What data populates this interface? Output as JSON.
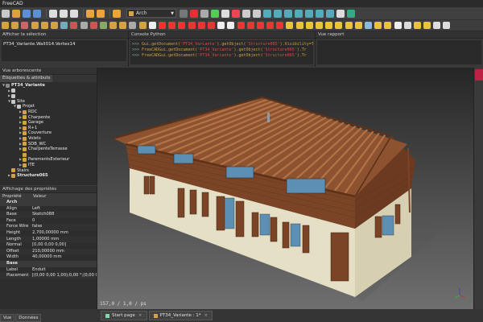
{
  "app": {
    "title": "FreeCAD"
  },
  "toolbar": {
    "workbench": "Arch",
    "row1_icons": [
      {
        "name": "new-file-icon",
        "color": "#c8c8c8"
      },
      {
        "name": "open-file-icon",
        "color": "#d9a23a"
      },
      {
        "name": "save-icon",
        "color": "#5b8fd6"
      },
      {
        "name": "save-as-icon",
        "color": "#5b8fd6"
      },
      {
        "name": "cut-icon",
        "color": "#ddd"
      },
      {
        "name": "copy-icon",
        "color": "#ddd"
      },
      {
        "name": "paste-icon",
        "color": "#ddd"
      },
      {
        "name": "undo-icon",
        "color": "#e9a53c"
      },
      {
        "name": "redo-icon",
        "color": "#e9a53c"
      },
      {
        "name": "refresh-icon",
        "color": "#e9a53c"
      }
    ],
    "row1_right_icons": [
      {
        "name": "macro-record-icon",
        "color": "#777"
      },
      {
        "name": "macro-stop-icon",
        "color": "#d33"
      },
      {
        "name": "macro-edit-icon",
        "color": "#aaa"
      },
      {
        "name": "macro-run-icon",
        "color": "#5c5"
      },
      {
        "name": "link-icon",
        "color": "#ddd"
      },
      {
        "name": "std-view-icon",
        "color": "#e45"
      },
      {
        "name": "fit-all-icon",
        "color": "#ccc"
      },
      {
        "name": "draw-style-icon",
        "color": "#ccc"
      },
      {
        "name": "view-iso-icon",
        "color": "#5ab"
      },
      {
        "name": "view-front-icon",
        "color": "#5ab"
      },
      {
        "name": "view-top-icon",
        "color": "#5ab"
      },
      {
        "name": "view-right-icon",
        "color": "#5ab"
      },
      {
        "name": "view-rear-icon",
        "color": "#5ab"
      },
      {
        "name": "view-bottom-icon",
        "color": "#5ab"
      },
      {
        "name": "view-left-icon",
        "color": "#5ab"
      },
      {
        "name": "measure-icon",
        "color": "#ddd"
      },
      {
        "name": "url-icon",
        "color": "#3a8"
      }
    ],
    "row2_icons": [
      {
        "name": "wall-icon",
        "color": "#d4a241"
      },
      {
        "name": "structure-icon",
        "color": "#d4a241"
      },
      {
        "name": "rebar-icon",
        "color": "#c66"
      },
      {
        "name": "floor-icon",
        "color": "#d4a241"
      },
      {
        "name": "building-icon",
        "color": "#d4a241"
      },
      {
        "name": "site-icon",
        "color": "#d4a241"
      },
      {
        "name": "window-icon",
        "color": "#7ab"
      },
      {
        "name": "roof-icon",
        "color": "#c55"
      },
      {
        "name": "axis-icon",
        "color": "#aaa"
      },
      {
        "name": "section-icon",
        "color": "#c55"
      },
      {
        "name": "space-icon",
        "color": "#8a6"
      },
      {
        "name": "stairs-icon",
        "color": "#d4a241"
      },
      {
        "name": "panel-icon",
        "color": "#d4a241"
      },
      {
        "name": "equipment-icon",
        "color": "#aaa"
      },
      {
        "name": "frame-icon",
        "color": "#d4a241"
      },
      {
        "name": "schedule-icon",
        "color": "#eee"
      },
      {
        "name": "line-icon",
        "color": "#e33"
      },
      {
        "name": "wire-icon",
        "color": "#e33"
      },
      {
        "name": "circle-icon",
        "color": "#e33"
      },
      {
        "name": "arc-icon",
        "color": "#e33"
      },
      {
        "name": "polygon-icon",
        "color": "#e33"
      },
      {
        "name": "rectangle-icon",
        "color": "#e33"
      },
      {
        "name": "text-icon",
        "color": "#eee"
      },
      {
        "name": "dimension-icon",
        "color": "#eee"
      },
      {
        "name": "bspline-icon",
        "color": "#e33"
      },
      {
        "name": "point-icon",
        "color": "#e33"
      },
      {
        "name": "shapestring-icon",
        "color": "#e33"
      },
      {
        "name": "facebinder-icon",
        "color": "#e33"
      },
      {
        "name": "bezcurve-icon",
        "color": "#e33"
      },
      {
        "name": "move-icon",
        "color": "#e9c33a"
      },
      {
        "name": "rotate-icon",
        "color": "#e9c33a"
      },
      {
        "name": "offset-icon",
        "color": "#e9c33a"
      },
      {
        "name": "trim-icon",
        "color": "#e9c33a"
      },
      {
        "name": "upgrade-icon",
        "color": "#e9c33a"
      },
      {
        "name": "downgrade-icon",
        "color": "#e9c33a"
      },
      {
        "name": "scale-icon",
        "color": "#e9c33a"
      },
      {
        "name": "edit-icon",
        "color": "#e9c33a"
      },
      {
        "name": "snap-icon",
        "color": "#8bd"
      },
      {
        "name": "array-icon",
        "color": "#e9c33a"
      },
      {
        "name": "clone-icon",
        "color": "#e9c33a"
      },
      {
        "name": "drawing-icon",
        "color": "#eee"
      },
      {
        "name": "wireframe-icon",
        "color": "#ddd"
      },
      {
        "name": "group-icon",
        "color": "#e9c33a"
      },
      {
        "name": "layer-icon",
        "color": "#e9c33a"
      },
      {
        "name": "grid-icon",
        "color": "#ddd"
      },
      {
        "name": "working-plane-icon",
        "color": "#ddd"
      }
    ]
  },
  "panels": {
    "selection": {
      "title": "Afficher la sélection",
      "content": "PT34_Variante.Wall014.Vertex14"
    },
    "python": {
      "title": "Console Python",
      "lines": [
        [
          "Gui.getDocument(",
          "'PT34_Variante'",
          ").getObject(",
          "'Structure065'",
          ").Visibility=True"
        ],
        [
          "FreeCADGui.getDocument(",
          "'PT34_Variante'",
          ").getObject(",
          "'Structure065'",
          ").Tr"
        ],
        [
          "FreeCADGui.getDocument(",
          "'PT34_Variante'",
          ").getObject(",
          "'Structure065'",
          ").Tr"
        ]
      ]
    },
    "report": {
      "title": "Vue rapport"
    },
    "tree": {
      "title": "Vue arborescente",
      "tab": "Étiquettes & attributs",
      "items": [
        {
          "label": "PT34_Variante",
          "indent": 0,
          "arrow": "▼",
          "color": "#8a8a8a",
          "bold": true
        },
        {
          "label": "",
          "indent": 1,
          "arrow": "▶",
          "color": "#c8c8c8"
        },
        {
          "label": "",
          "indent": 1,
          "arrow": "▶",
          "color": "#c8c8c8"
        },
        {
          "label": "Site",
          "indent": 1,
          "arrow": "▼",
          "color": "#c8c8c8"
        },
        {
          "label": "Projet",
          "indent": 2,
          "arrow": "▼",
          "color": "#c8c8c8"
        },
        {
          "label": "RDC",
          "indent": 3,
          "arrow": "▶",
          "color": "#d4a241"
        },
        {
          "label": "Charpente",
          "indent": 3,
          "arrow": "▶",
          "color": "#d4a241"
        },
        {
          "label": "Garage",
          "indent": 3,
          "arrow": "▶",
          "color": "#d4a241"
        },
        {
          "label": "R+1",
          "indent": 3,
          "arrow": "▶",
          "color": "#d4a241"
        },
        {
          "label": "Couverture",
          "indent": 3,
          "arrow": "▶",
          "color": "#d4a241"
        },
        {
          "label": "Volets",
          "indent": 3,
          "arrow": "▶",
          "color": "#d4a241"
        },
        {
          "label": "SDB_WC",
          "indent": 3,
          "arrow": "▶",
          "color": "#d4a241"
        },
        {
          "label": "CharpenteTerrasse",
          "indent": 3,
          "arrow": "▶",
          "color": "#d4a241"
        },
        {
          "label": "",
          "indent": 3,
          "arrow": "",
          "color": "#d4a241"
        },
        {
          "label": "ParementsExterieur",
          "indent": 3,
          "arrow": "▶",
          "color": "#d4a241"
        },
        {
          "label": "ITE",
          "indent": 3,
          "arrow": "▶",
          "color": "#d4a241"
        },
        {
          "label": "Stairs",
          "indent": 1,
          "arrow": "",
          "color": "#d4a241"
        },
        {
          "label": "Structure065",
          "indent": 1,
          "arrow": "▶",
          "color": "#d4a241",
          "bold": true
        }
      ]
    },
    "properties": {
      "title": "Affichage des propriétés",
      "col_prop": "Propriété",
      "col_val": "Valeur",
      "rows": [
        {
          "group": "Arch"
        },
        {
          "name": "Align",
          "value": "Left"
        },
        {
          "name": "Base",
          "value": "Sketch088"
        },
        {
          "name": "Face",
          "value": "0"
        },
        {
          "name": "Force Wire",
          "value": "false"
        },
        {
          "name": "Height",
          "value": "2,700,00000 mm"
        },
        {
          "name": "Length",
          "value": "1,00000 mm"
        },
        {
          "name": "Normal",
          "value": "[0,00 0,00 0,00]"
        },
        {
          "name": "Offset",
          "value": "210,00000 mm"
        },
        {
          "name": "Width",
          "value": "40,00000 mm"
        },
        {
          "group": "Base"
        },
        {
          "name": "Label",
          "value": "Enduit"
        },
        {
          "name": "Placement",
          "value": "[(0,00 0,00 1,00);0,00 °;(0,00 0,00 0,00"
        }
      ]
    },
    "left_tabs": [
      "Vue",
      "Données"
    ]
  },
  "viewport": {
    "coords": "157,0 / 1,0 / ps",
    "tabs": [
      {
        "label": "Start page",
        "close": "×"
      },
      {
        "label": "PT34_Variante : 1*",
        "close": "×"
      }
    ]
  },
  "colors": {
    "siding": "#7b4426",
    "plaster": "#e5dfc6",
    "rafter": "#9a5a33",
    "window": "#5b8fb3"
  }
}
